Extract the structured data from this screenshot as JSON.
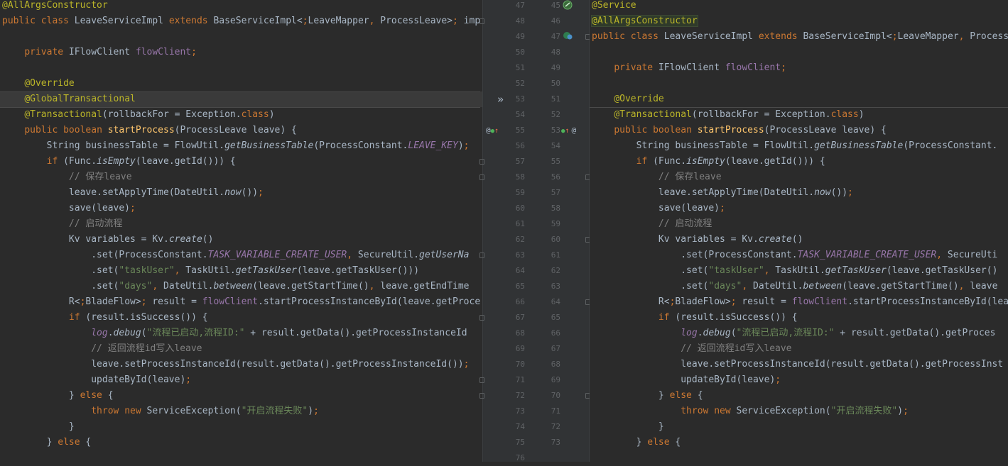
{
  "left": {
    "lines": [
      "@AllArgsConstructor",
      "public class LeaveServiceImpl extends BaseServiceImpl<LeaveMapper, ProcessLeave> imp",
      "",
      "    private IFlowClient flowClient;",
      "",
      "    @Override",
      "    @GlobalTransactional",
      "    @Transactional(rollbackFor = Exception.class)",
      "    public boolean startProcess(ProcessLeave leave) {",
      "        String businessTable = FlowUtil.getBusinessTable(ProcessConstant.LEAVE_KEY);",
      "        if (Func.isEmpty(leave.getId())) {",
      "            // 保存leave",
      "            leave.setApplyTime(DateUtil.now());",
      "            save(leave);",
      "            // 启动流程",
      "            Kv variables = Kv.create()",
      "                .set(ProcessConstant.TASK_VARIABLE_CREATE_USER, SecureUtil.getUserNa",
      "                .set(\"taskUser\", TaskUtil.getTaskUser(leave.getTaskUser()))",
      "                .set(\"days\", DateUtil.between(leave.getStartTime(), leave.getEndTime",
      "            R<BladeFlow> result = flowClient.startProcessInstanceById(leave.getProce",
      "            if (result.isSuccess()) {",
      "                log.debug(\"流程已启动,流程ID:\" + result.getData().getProcessInstanceId",
      "                // 返回流程id写入leave",
      "                leave.setProcessInstanceId(result.getData().getProcessInstanceId());",
      "                updateById(leave);",
      "            } else {",
      "                throw new ServiceException(\"开启流程失败\");",
      "            }",
      "        } else {"
    ],
    "line_numbers": [
      "47",
      "48",
      "49",
      "50",
      "51",
      "52",
      "53",
      "54",
      "55",
      "56",
      "57",
      "58",
      "59",
      "60",
      "61",
      "62",
      "63",
      "64",
      "65",
      "66",
      "67",
      "68",
      "69",
      "70",
      "71",
      "72",
      "73",
      "74",
      "75",
      "76"
    ]
  },
  "right": {
    "lines": [
      "@Service",
      "@AllArgsConstructor",
      "public class LeaveServiceImpl extends BaseServiceImpl<LeaveMapper, Process",
      "",
      "    private IFlowClient flowClient;",
      "",
      "    @Override",
      "    @Transactional(rollbackFor = Exception.class)",
      "    public boolean startProcess(ProcessLeave leave) {",
      "        String businessTable = FlowUtil.getBusinessTable(ProcessConstant.",
      "        if (Func.isEmpty(leave.getId())) {",
      "            // 保存leave",
      "            leave.setApplyTime(DateUtil.now());",
      "            save(leave);",
      "            // 启动流程",
      "            Kv variables = Kv.create()",
      "                .set(ProcessConstant.TASK_VARIABLE_CREATE_USER, SecureUti",
      "                .set(\"taskUser\", TaskUtil.getTaskUser(leave.getTaskUser()",
      "                .set(\"days\", DateUtil.between(leave.getStartTime(), leave",
      "            R<BladeFlow> result = flowClient.startProcessInstanceById(lea",
      "            if (result.isSuccess()) {",
      "                log.debug(\"流程已启动,流程ID:\" + result.getData().getProces",
      "                // 返回流程id写入leave",
      "                leave.setProcessInstanceId(result.getData().getProcessInst",
      "                updateById(leave);",
      "            } else {",
      "                throw new ServiceException(\"开启流程失败\");",
      "            }",
      "        } else {"
    ],
    "line_numbers": [
      "45",
      "46",
      "47",
      "48",
      "49",
      "50",
      "51",
      "52",
      "53",
      "54",
      "55",
      "56",
      "57",
      "58",
      "59",
      "60",
      "61",
      "62",
      "63",
      "64",
      "65",
      "66",
      "67",
      "68",
      "69",
      "70",
      "71",
      "72",
      "73"
    ]
  },
  "gutter": {
    "arrows": "»",
    "at_sign": "@",
    "override_icon": "override-up-arrow-icon",
    "bean_icon": "spring-bean-icon"
  },
  "colors": {
    "background": "#2b2b2b",
    "gutter": "#313335",
    "keyword": "#cc7832",
    "annotation": "#bbb529",
    "string": "#6a8759",
    "comment": "#808080",
    "field": "#9876aa",
    "method": "#ffc66d",
    "text": "#a9b7c6"
  }
}
